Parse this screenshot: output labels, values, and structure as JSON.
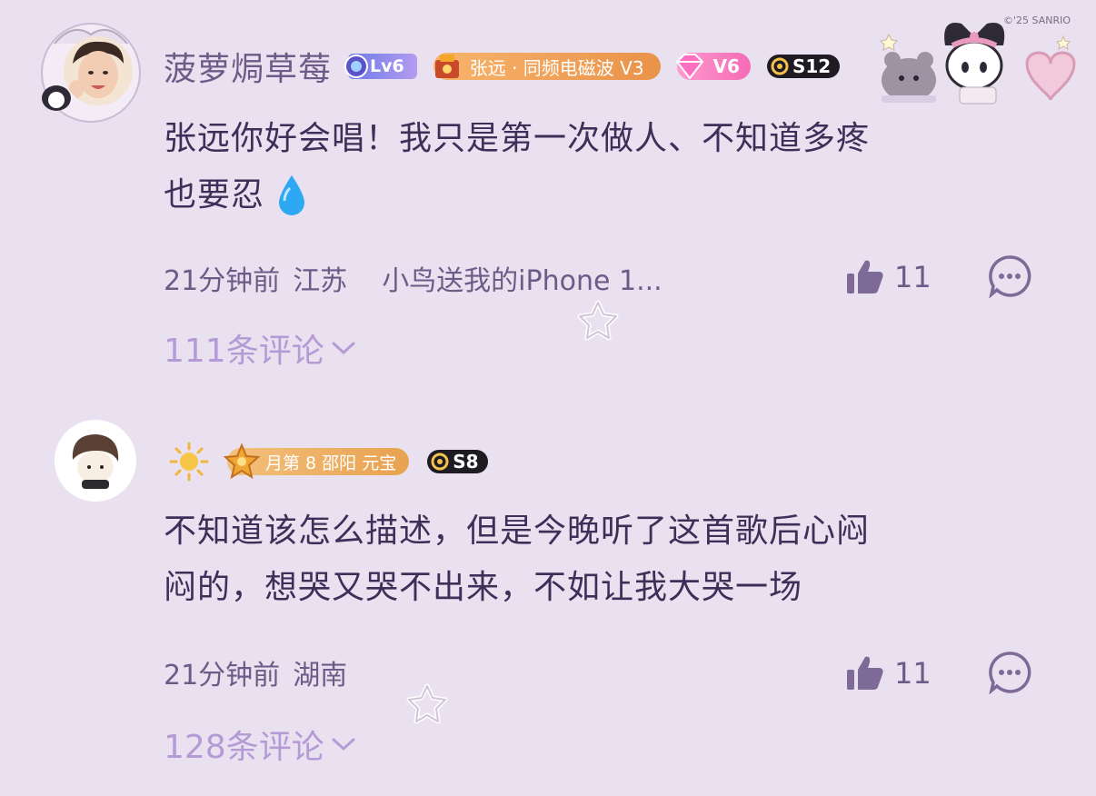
{
  "comments": [
    {
      "username": "菠萝焗草莓",
      "level_badge": "Lv6",
      "fan_badge": "张远 · 同频电磁波 V3",
      "vip_badge": "V6",
      "season_badge": "S12",
      "text_line1": "张远你好会唱！我只是第一次做人、不知道多疼",
      "text_line2": "也要忍",
      "time": "21分钟前",
      "location": "江苏",
      "device": "小鸟送我的iPhone 1...",
      "likes": "11",
      "replies": "111条评论"
    },
    {
      "username": "",
      "fan_badge": "月第 8 邵阳 元宝",
      "season_badge": "S8",
      "text_line1": "不知道该怎么描述，但是今晚听了这首歌后心闷",
      "text_line2": "闷的，想哭又哭不出来，不如让我大哭一场",
      "time": "21分钟前",
      "location": "湖南",
      "likes": "11",
      "replies": "128条评论"
    }
  ],
  "decoration": {
    "copyright": "©'25 SANRIO"
  },
  "colors": {
    "background": "#E9E1F0",
    "text": "#3F2E58",
    "meta": "#6E5A86",
    "expand": "#B59BD6"
  }
}
